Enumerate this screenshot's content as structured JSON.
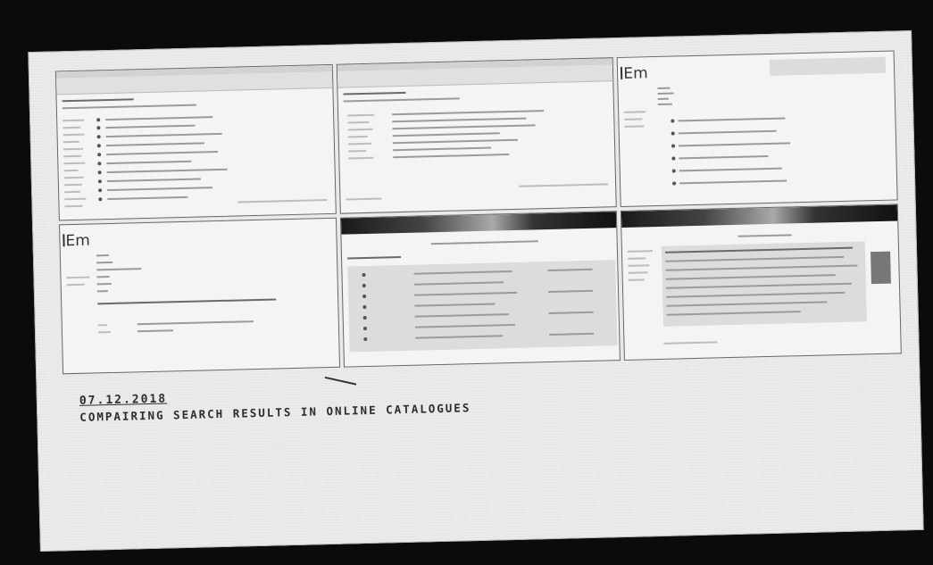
{
  "photo": {
    "caption_date": "07.12.2018",
    "caption_title": "COMPAIRING SEARCH RESULTS IN ONLINE CATALOGUES"
  },
  "screenshots": [
    {
      "name": "catalogue-results-list-a",
      "logo": ""
    },
    {
      "name": "catalogue-results-list-b",
      "logo": ""
    },
    {
      "name": "catalogue-record-em-a",
      "logo": "Em"
    },
    {
      "name": "catalogue-record-em-b",
      "logo": "Em"
    },
    {
      "name": "catalogue-results-table",
      "logo": ""
    },
    {
      "name": "catalogue-record-detail",
      "logo": ""
    }
  ]
}
